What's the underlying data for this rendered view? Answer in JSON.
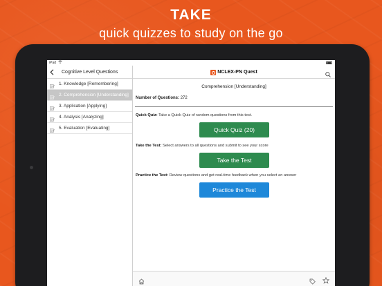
{
  "promo": {
    "headline": "TAKE",
    "subheadline": "quick quizzes to study on the go"
  },
  "statusbar": {
    "device": "iPad"
  },
  "sidebar": {
    "title": "Cognitive Level Questions",
    "items": [
      {
        "label": "1. Knowledge [Remembering]",
        "selected": false
      },
      {
        "label": "2. Comprehension [Understanding]",
        "selected": true
      },
      {
        "label": "3. Application [Applying]",
        "selected": false
      },
      {
        "label": "4. Analysis [Analyzing]",
        "selected": false
      },
      {
        "label": "5. Evaluation [Evaluating]",
        "selected": false
      }
    ]
  },
  "main": {
    "app_title": "NCLEX-PN Quest",
    "section_title": "Comprehension [Understanding]",
    "num_questions_label": "Number of Questions:",
    "num_questions_value": "272",
    "quick_quiz": {
      "label": "Quick Quiz:",
      "description": "Take a Quick Quiz of random questions from this test.",
      "button": "Quick Quiz (20)"
    },
    "take_test": {
      "label": "Take the Test:",
      "description": "Select answers to all questions and submit to see your score",
      "button": "Take the Test"
    },
    "practice_test": {
      "label": "Practice the Test:",
      "description": "Review questions and get real-time feedback when you select an answer",
      "button": "Practice the Test"
    }
  },
  "toolbar": {
    "icons": [
      "home-icon",
      "tag-icon",
      "star-icon"
    ]
  },
  "colors": {
    "background": "#e8571e",
    "quick_quiz_button": "#2e8b4f",
    "take_test_button": "#2e8b4f",
    "practice_button": "#1e88d9",
    "selected_row": "#c6c6c6"
  }
}
